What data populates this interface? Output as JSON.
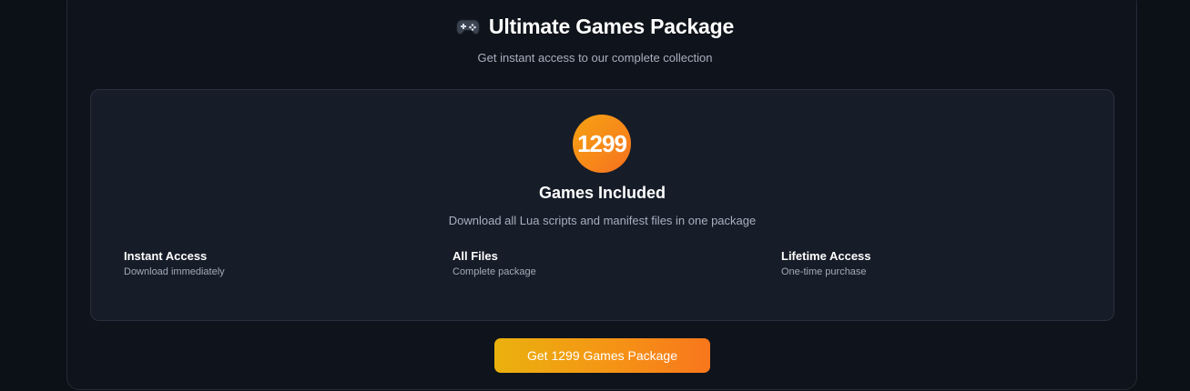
{
  "header": {
    "icon": "gamepad-icon",
    "title": "Ultimate Games Package",
    "subtitle": "Get instant access to our complete collection"
  },
  "package": {
    "count": "1299",
    "title": "Games Included",
    "description": "Download all Lua scripts and manifest files in one package",
    "features": [
      {
        "title": "Instant Access",
        "subtitle": "Download immediately"
      },
      {
        "title": "All Files",
        "subtitle": "Complete package"
      },
      {
        "title": "Lifetime Access",
        "subtitle": "One-time purchase"
      }
    ]
  },
  "cta": {
    "label": "Get 1299 Games Package"
  },
  "colors": {
    "background": "#0c1017",
    "card": "#161c28",
    "accent_start": "#eab10e",
    "accent_end": "#f8761c"
  }
}
